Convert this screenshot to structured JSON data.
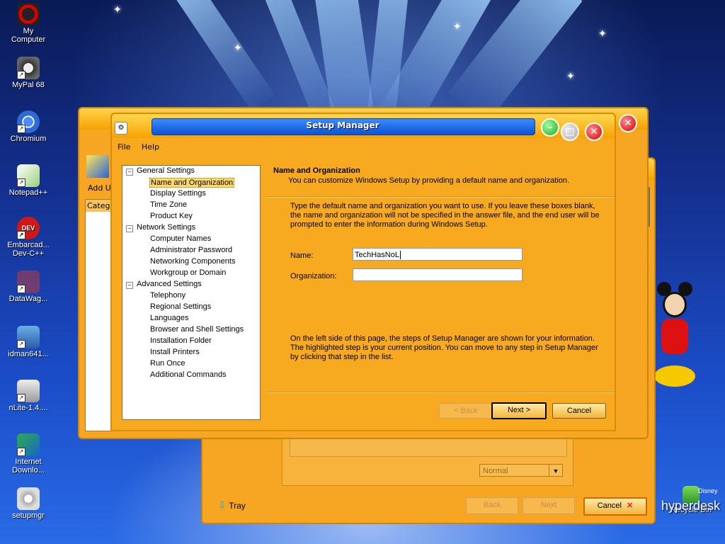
{
  "desktop": {
    "icons": [
      {
        "label": "My\nComputer",
        "icon": "my-computer-icon"
      },
      {
        "label": "MyPal 68",
        "icon": "mypal-icon"
      },
      {
        "label": "Chromium",
        "icon": "chromium-icon"
      },
      {
        "label": "Notepad++",
        "icon": "notepadpp-icon"
      },
      {
        "label": "Embarcad...\nDev-C++",
        "icon": "devcpp-icon"
      },
      {
        "label": "DataWag...",
        "icon": "datawag-icon"
      },
      {
        "label": "idman641...",
        "icon": "idman-icon"
      },
      {
        "label": "nLite-1.4....",
        "icon": "nlite-icon"
      },
      {
        "label": "Internet\nDownlo...",
        "icon": "idm-icon"
      },
      {
        "label": "setupmgr",
        "icon": "setupmgr-icon"
      },
      {
        "label": "Recycle Bin",
        "icon": "recycle-bin-icon"
      }
    ],
    "branding": {
      "disney": "Disney",
      "hyperdesk": "hyperdesk"
    }
  },
  "back_window_left": {
    "toolbar_label": "Add U",
    "category_label": "Categ"
  },
  "back_window_right": {
    "dropdown_value": "Normal",
    "tray_label": "Tray",
    "back_label": "Back",
    "next_label": "Next",
    "cancel_label": "Cancel"
  },
  "main": {
    "title": "Setup Manager",
    "menu": [
      "File",
      "Help"
    ],
    "tree": {
      "general": "General Settings",
      "general_items": [
        "Name and Organization",
        "Display Settings",
        "Time Zone",
        "Product Key"
      ],
      "network": "Network Settings",
      "network_items": [
        "Computer Names",
        "Administrator Password",
        "Networking Components",
        "Workgroup or Domain"
      ],
      "advanced": "Advanced Settings",
      "advanced_items": [
        "Telephony",
        "Regional Settings",
        "Languages",
        "Browser and Shell Settings",
        "Installation Folder",
        "Install Printers",
        "Run Once",
        "Additional Commands"
      ],
      "selected": "Name and Organization"
    },
    "header": {
      "title": "Name and Organization",
      "subtitle": "You can customize Windows Setup by providing a default name and organization."
    },
    "intro": "Type the default name and organization you want to use. If you leave these boxes blank, the name and organization will not be specified in the answer file, and the end user will be prompted to enter the information during Windows Setup.",
    "fields": {
      "name_label": "Name:",
      "name_value": "TechHasNoL",
      "org_label": "Organization:",
      "org_value": ""
    },
    "footer_text": "On the left side of this page, the steps of Setup Manager are shown for your information. The highlighted step is your current position. You can move to any step in Setup Manager by clicking that step in the list.",
    "buttons": {
      "back": "< Back",
      "next": "Next >",
      "cancel": "Cancel"
    }
  }
}
